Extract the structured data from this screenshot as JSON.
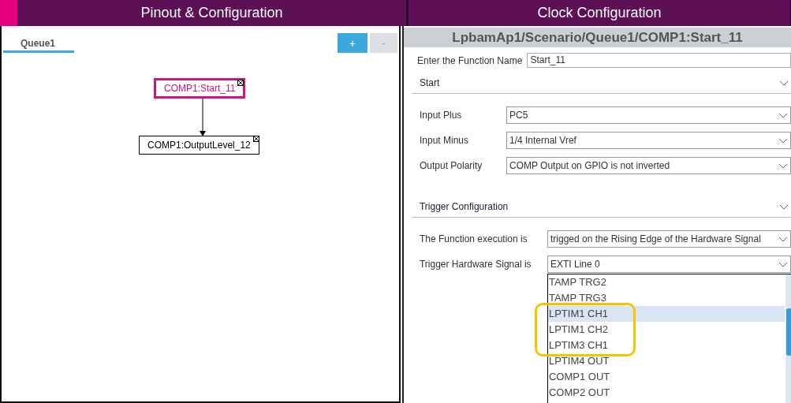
{
  "header_tabs": [
    {
      "label": "Pinout & Configuration"
    },
    {
      "label": "Clock Configuration"
    }
  ],
  "queue_panel": {
    "tabs": [
      {
        "label": "Queue1",
        "selected": true
      }
    ],
    "buttons": [
      {
        "label": "+",
        "disabled": false
      },
      {
        "label": "-",
        "disabled": true
      }
    ],
    "nodes": [
      {
        "label": "COMP1:Start_11",
        "selected": true
      },
      {
        "label": "COMP1:OutputLevel_12",
        "selected": false
      }
    ]
  },
  "properties": {
    "title": "LpbamAp1/Scenario/Queue1/COMP1:Start_11",
    "function_name": {
      "label": "Enter the Function Name",
      "value": "Start_11"
    },
    "sections": [
      {
        "title": "Start",
        "expanded": true,
        "fields": [
          {
            "label": "Input Plus",
            "value": "PC5"
          },
          {
            "label": "Input Minus",
            "value": "1/4 Internal Vref"
          },
          {
            "label": "Output Polarity",
            "value": "COMP Output on GPIO is not inverted"
          }
        ]
      },
      {
        "title": "Trigger Configuration",
        "expanded": true,
        "fields": [
          {
            "label": "The Function execution is",
            "value": "trigged on the Rising Edge of the Hardware Signal"
          },
          {
            "label": "Trigger Hardware Signal is",
            "value": "EXTI Line 0"
          }
        ]
      }
    ],
    "dropdown": {
      "items": [
        {
          "label": "TAMP TRG2",
          "selected": false,
          "highlighted": false
        },
        {
          "label": "TAMP TRG3",
          "selected": false,
          "highlighted": false
        },
        {
          "label": "LPTIM1 CH1",
          "selected": true,
          "highlighted": true
        },
        {
          "label": "LPTIM1 CH2",
          "selected": false,
          "highlighted": true
        },
        {
          "label": "LPTIM3 CH1",
          "selected": false,
          "highlighted": true
        },
        {
          "label": "LPTIM4 OUT",
          "selected": false,
          "highlighted": false
        },
        {
          "label": "COMP1 OUT",
          "selected": false,
          "highlighted": false
        },
        {
          "label": "COMP2 OUT",
          "selected": false,
          "highlighted": false
        }
      ]
    }
  }
}
